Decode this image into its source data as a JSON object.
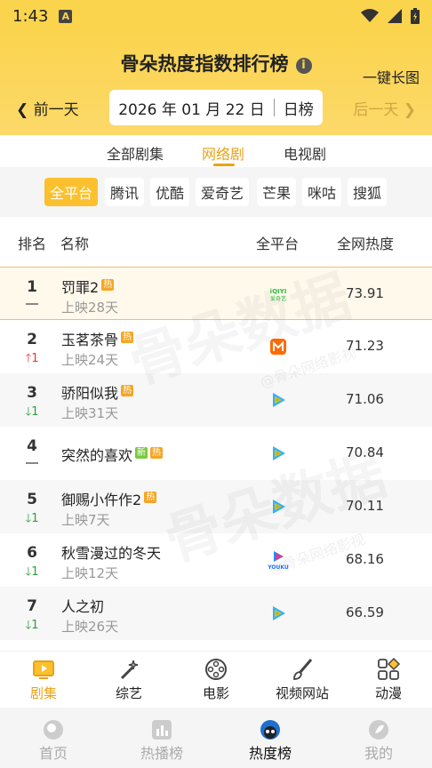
{
  "status_bar": {
    "time": "1:43",
    "app_badge": "A"
  },
  "header": {
    "title": "骨朵热度指数排行榜",
    "info_icon": "i",
    "long_image": "一键长图",
    "prev_day": "前一天",
    "next_day": "后一天",
    "date": "2026 年 01 月 22 日",
    "period": "日榜"
  },
  "tabs": [
    {
      "label": "全部剧集",
      "active": false
    },
    {
      "label": "网络剧",
      "active": true
    },
    {
      "label": "电视剧",
      "active": false
    }
  ],
  "platforms": [
    {
      "label": "全平台",
      "active": true
    },
    {
      "label": "腾讯",
      "active": false
    },
    {
      "label": "优酷",
      "active": false
    },
    {
      "label": "爱奇艺",
      "active": false
    },
    {
      "label": "芒果",
      "active": false
    },
    {
      "label": "咪咕",
      "active": false
    },
    {
      "label": "搜狐",
      "active": false
    }
  ],
  "table_header": {
    "rank": "排名",
    "name": "名称",
    "platform": "全平台",
    "heat": "全网热度"
  },
  "rows": [
    {
      "rank": "1",
      "change": "",
      "direction": "flat",
      "name": "罚罪2",
      "badges": [
        "热"
      ],
      "days": "上映28天",
      "platform": "iqiyi-icon",
      "heat": "73.91"
    },
    {
      "rank": "2",
      "change": "1",
      "direction": "up",
      "name": "玉茗茶骨",
      "badges": [
        "热"
      ],
      "days": "上映24天",
      "platform": "mango-icon",
      "heat": "71.23"
    },
    {
      "rank": "3",
      "change": "1",
      "direction": "down",
      "name": "骄阳似我",
      "badges": [
        "热"
      ],
      "days": "上映31天",
      "platform": "tencent-video-icon",
      "heat": "71.06"
    },
    {
      "rank": "4",
      "change": "",
      "direction": "flat",
      "name": "突然的喜欢",
      "badges": [
        "新",
        "热"
      ],
      "days": "",
      "platform": "tencent-video-icon",
      "heat": "70.84"
    },
    {
      "rank": "5",
      "change": "1",
      "direction": "down",
      "name": "御赐小仵作2",
      "badges": [
        "热"
      ],
      "days": "上映7天",
      "platform": "tencent-video-icon",
      "heat": "70.11"
    },
    {
      "rank": "6",
      "change": "1",
      "direction": "down",
      "name": "秋雪漫过的冬天",
      "badges": [],
      "days": "上映12天",
      "platform": "youku-icon",
      "heat": "68.16"
    },
    {
      "rank": "7",
      "change": "1",
      "direction": "down",
      "name": "人之初",
      "badges": [],
      "days": "上映26天",
      "platform": "tencent-video-icon",
      "heat": "66.59"
    }
  ],
  "watermark": {
    "main": "骨朵数据",
    "sub": "@骨朵网络影视"
  },
  "category_nav": [
    {
      "label": "剧集",
      "icon": "tv-icon",
      "active": true
    },
    {
      "label": "综艺",
      "icon": "magic-wand-icon",
      "active": false
    },
    {
      "label": "电影",
      "icon": "film-reel-icon",
      "active": false
    },
    {
      "label": "视频网站",
      "icon": "brush-icon",
      "active": false
    },
    {
      "label": "动漫",
      "icon": "shapes-icon",
      "active": false
    }
  ],
  "bottom_nav": [
    {
      "label": "首页",
      "icon": "home-icon",
      "active": false
    },
    {
      "label": "热播榜",
      "icon": "chart-icon",
      "active": false
    },
    {
      "label": "热度榜",
      "icon": "hot-rank-icon",
      "active": true
    },
    {
      "label": "我的",
      "icon": "profile-icon",
      "active": false
    }
  ],
  "colors": {
    "brand_yellow": "#fbd44e",
    "accent": "#e8a317",
    "up": "#e53935",
    "down": "#2e9e3e"
  }
}
